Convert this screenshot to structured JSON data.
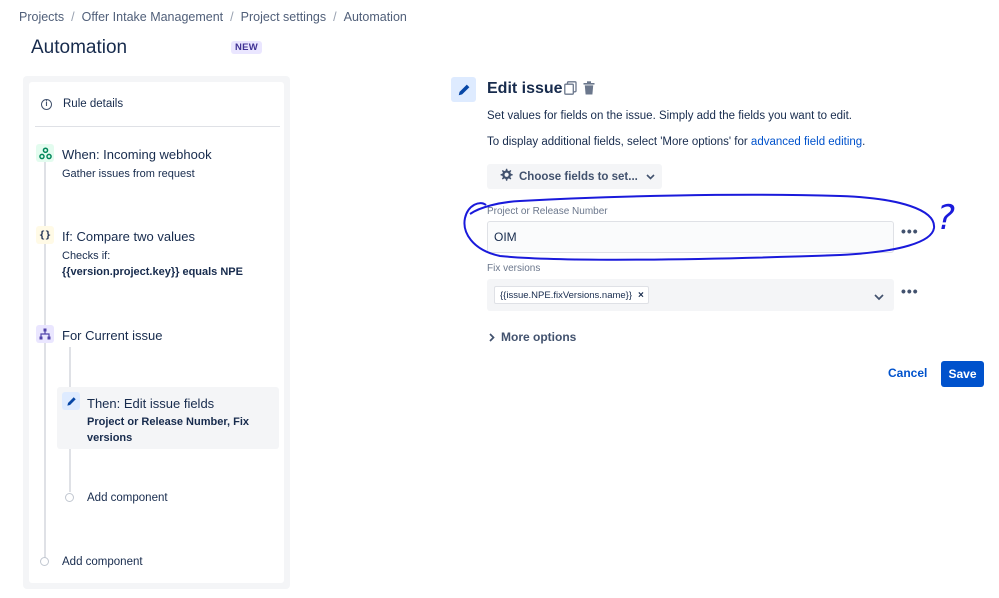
{
  "breadcrumb": {
    "items": [
      "Projects",
      "Offer Intake Management",
      "Project settings",
      "Automation"
    ],
    "separator": "/"
  },
  "page": {
    "title": "Automation",
    "badge": "NEW"
  },
  "rule": {
    "details_label": "Rule details",
    "components": [
      {
        "title": "When: Incoming webhook",
        "sub": "Gather issues from request",
        "icon": "webhook-icon"
      },
      {
        "title": "If: Compare two values",
        "sub1": "Checks if:",
        "sub2": "{{version.project.key}} equals NPE",
        "icon": "braces-icon"
      },
      {
        "title": "For Current issue",
        "icon": "branch-icon"
      },
      {
        "title": "Then: Edit issue fields",
        "sub1": "Project or Release Number, Fix",
        "sub2": "versions",
        "icon": "pencil-icon"
      }
    ],
    "add_component_inner": "Add component",
    "add_component_outer": "Add component"
  },
  "editor": {
    "title": "Edit issue",
    "desc1": "Set values for fields on the issue. Simply add the fields you want to edit.",
    "desc2_prefix": "To display additional fields, select 'More options' for ",
    "desc2_link": "advanced field editing",
    "desc2_suffix": ".",
    "choose_fields": "Choose fields to set...",
    "field1_label": "Project or Release Number",
    "field1_value": "OIM",
    "field2_label": "Fix versions",
    "field2_tag": "{{issue.NPE.fixVersions.name}}",
    "more_options": "More options",
    "cancel": "Cancel",
    "save": "Save"
  },
  "annotation": {
    "mark": "?",
    "color": "#1a1adb"
  },
  "colors": {
    "primary": "#0052CC",
    "text": "#172B4D",
    "subtle": "#F4F5F7"
  }
}
